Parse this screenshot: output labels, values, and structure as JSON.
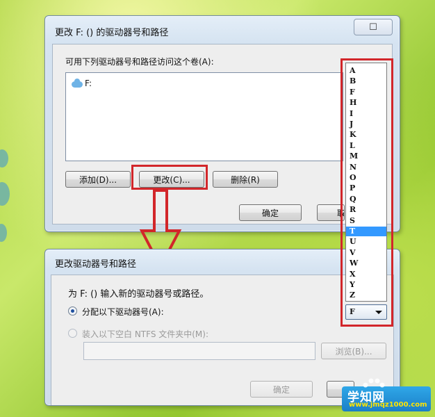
{
  "dialog_change": {
    "title": "更改 F: () 的驱动器号和路径",
    "close_glyph": "☐",
    "instruction": "可用下列驱动器号和路径访问这个卷(A):",
    "list_items": [
      {
        "label": "F:",
        "icon": "drive-cloud-icon"
      }
    ],
    "buttons": {
      "add": "添加(D)...",
      "change": "更改(C)...",
      "delete": "删除(R)",
      "ok": "确定",
      "cancel_peek": "取"
    }
  },
  "dialog_edit": {
    "title": "更改驱动器号和路径",
    "instruction": "为 F: () 输入新的驱动器号或路径。",
    "option_assign": "分配以下驱动器号(A):",
    "option_mount": "装入以下空白 NTFS 文件夹中(M):",
    "browse_label": "浏览(B)...",
    "ok_label": "确定",
    "selected_letter": "F"
  },
  "drive_letters": [
    "A",
    "B",
    "F",
    "H",
    "I",
    "J",
    "K",
    "L",
    "M",
    "N",
    "O",
    "P",
    "Q",
    "R",
    "S",
    "T",
    "U",
    "V",
    "W",
    "X",
    "Y",
    "Z"
  ],
  "selected_drive_letter": "T",
  "watermark": {
    "main": "学知网",
    "sub": "www.jmqz1000.com"
  },
  "colors": {
    "highlight_red": "#d2262a",
    "selection_blue": "#3399ff",
    "watermark_blue": "#1b7fc7",
    "watermark_yellow": "#ffe400"
  }
}
